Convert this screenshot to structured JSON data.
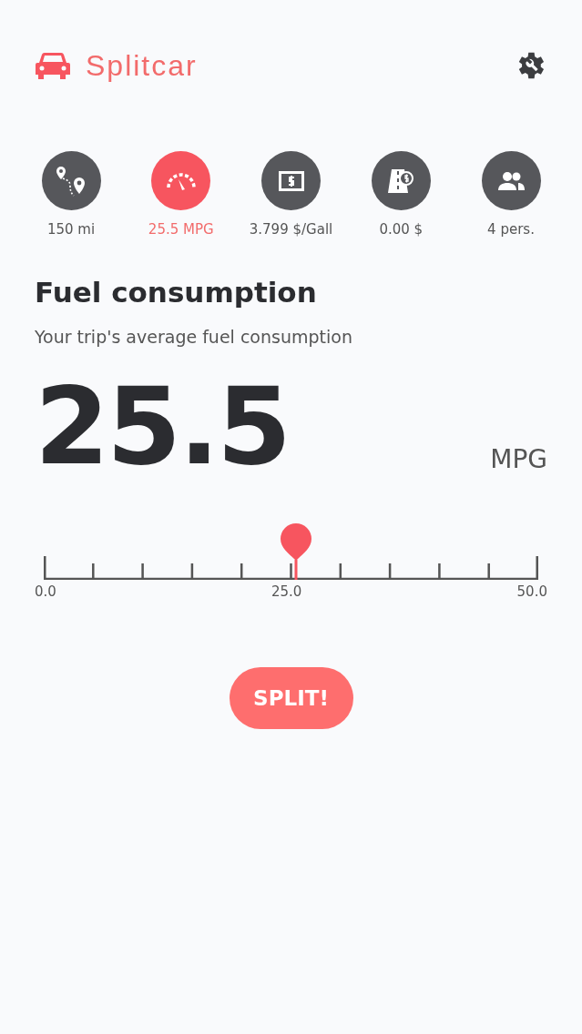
{
  "app": {
    "title": "Splitcar"
  },
  "tabs": [
    {
      "kind": "route",
      "label": "150 mi",
      "selected": false
    },
    {
      "kind": "gauge",
      "label": "25.5 MPG",
      "selected": true
    },
    {
      "kind": "money",
      "label": "3.799 $/Gall",
      "selected": false
    },
    {
      "kind": "toll",
      "label": "0.00 $",
      "selected": false
    },
    {
      "kind": "people",
      "label": "4 pers.",
      "selected": false
    }
  ],
  "section": {
    "title": "Fuel consumption",
    "subtitle": "Your trip's average fuel consumption",
    "value": "25.5",
    "unit": "MPG"
  },
  "slider": {
    "level": 0.51,
    "scale_labels": [
      "0.0",
      "25.0",
      "50.0"
    ]
  },
  "button": {
    "label": "SPLIT!"
  }
}
